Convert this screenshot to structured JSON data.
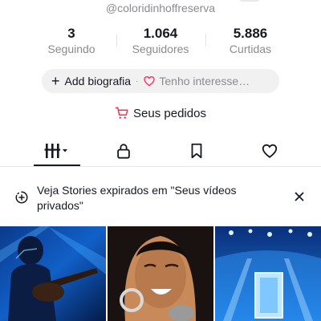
{
  "profile": {
    "handle": "@coloridinhoffreserva"
  },
  "stats": [
    {
      "value": "3",
      "label": "Seguindo"
    },
    {
      "value": "1.064",
      "label": "Seguidores"
    },
    {
      "value": "5.886",
      "label": "Curtidas"
    }
  ],
  "bio_bar": {
    "add_bio_label": "Add biografia",
    "interest_label": "Tenho interesse…",
    "separator": "·"
  },
  "orders": {
    "label": "Seus pedidos"
  },
  "tabs": [
    {
      "icon": "videos-grid-icon",
      "active": true
    },
    {
      "icon": "lock-icon",
      "active": false
    },
    {
      "icon": "bookmark-icon",
      "active": false
    },
    {
      "icon": "heart-icon",
      "active": false
    }
  ],
  "stories_banner": {
    "text": "Veja Stories expirados em \"Seus vídeos privados\""
  },
  "videos": [
    {
      "thumbnail": "guitar-performer-blue-stage"
    },
    {
      "thumbnail": "singer-with-microphone"
    },
    {
      "thumbnail": "stage-screen-blue-lights"
    }
  ],
  "colors": {
    "text_primary": "#161823",
    "text_secondary": "#8a8b91",
    "accent_red": "#fe2c55",
    "pill_bg": "#f1f1f2"
  }
}
